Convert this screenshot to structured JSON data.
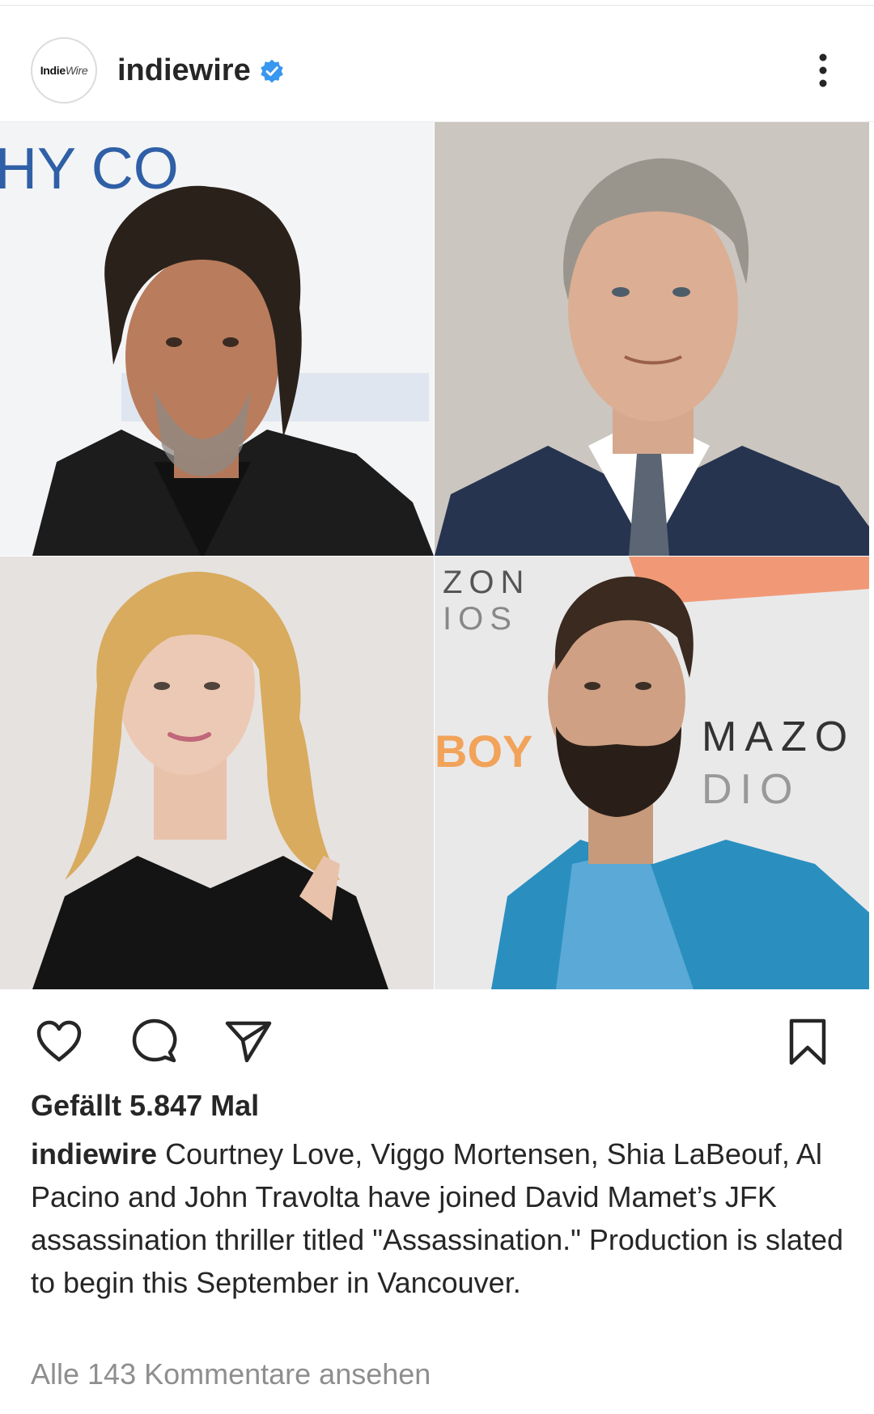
{
  "post": {
    "avatar_logo": {
      "part1": "Indie",
      "part2": "Wire"
    },
    "username": "indiewire",
    "verified": true,
    "accent_color": "#3897f0",
    "photos": [
      {
        "name": "al-pacino",
        "backdrop_text": "HY CO"
      },
      {
        "name": "viggo-mortensen",
        "backdrop_text": ""
      },
      {
        "name": "courtney-love",
        "backdrop_text": ""
      },
      {
        "name": "shia-labeouf",
        "backdrop_text": "ZON IOS MAZO DIO"
      }
    ],
    "icons": [
      "heart-icon",
      "comment-icon",
      "share-icon",
      "bookmark-icon",
      "more-icon",
      "verified-icon"
    ],
    "likes_text": "Gefällt 5.847 Mal",
    "caption_user": "indiewire",
    "caption_text": "Courtney Love, Viggo Mortensen, Shia LaBeouf, Al Pacino and John Travolta have joined David Mamet’s JFK assassination thriller titled \"Assassination.\" Production is slated to begin this September in Vancouver.",
    "view_comments": "Alle 143 Kommentare ansehen"
  }
}
